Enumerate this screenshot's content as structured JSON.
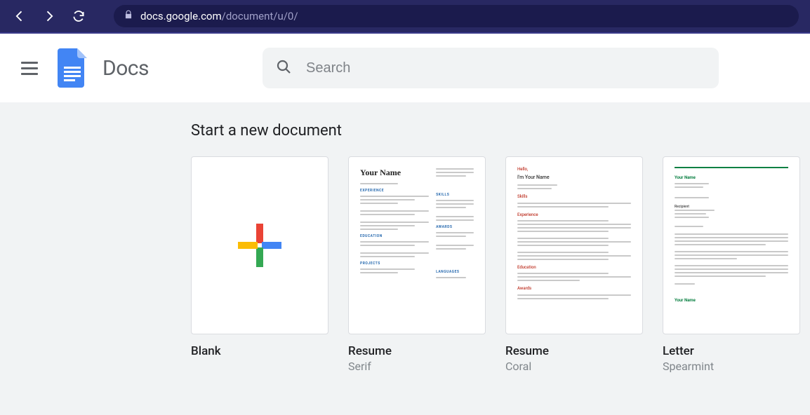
{
  "browser": {
    "url_host": "docs.google.com",
    "url_path": "/document/u/0/"
  },
  "header": {
    "app_title": "Docs",
    "search_placeholder": "Search"
  },
  "templates": {
    "section_title": "Start a new document",
    "cards": [
      {
        "title": "Blank",
        "subtitle": ""
      },
      {
        "title": "Resume",
        "subtitle": "Serif"
      },
      {
        "title": "Resume",
        "subtitle": "Coral"
      },
      {
        "title": "Letter",
        "subtitle": "Spearmint"
      }
    ]
  }
}
